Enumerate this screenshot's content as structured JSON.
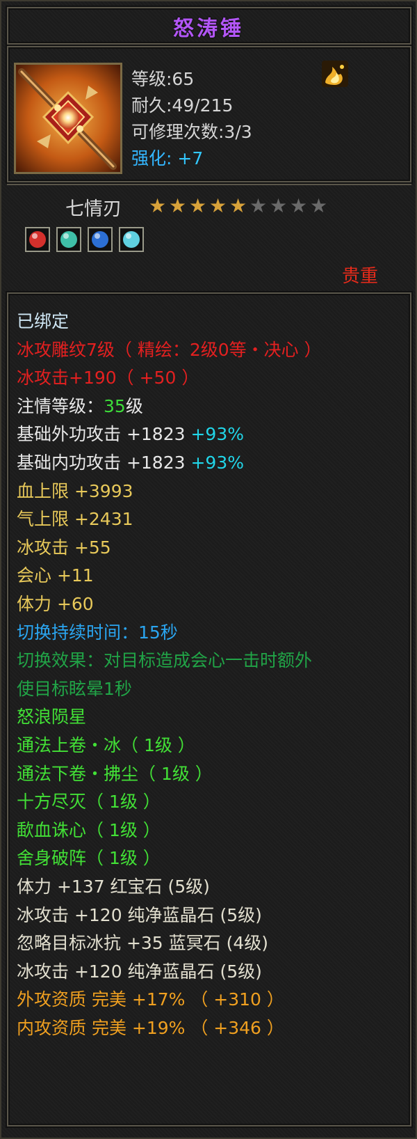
{
  "item": {
    "name": "怒涛锤",
    "level_text": "等级:65",
    "durability_text": "耐久:49/215",
    "repair_text": "可修理次数:3/3",
    "enhance_label": "强化:",
    "enhance_value": "+7",
    "badge_icon": "gold-flame-icon",
    "item_icon": "ornate-hammer-icon"
  },
  "set": {
    "name": "七情刃",
    "stars_total": 9,
    "stars_filled": 5,
    "star_color_filled": "#d8a23a",
    "star_color_empty": "#6a6a6a"
  },
  "gems": [
    {
      "icon": "red-gem-icon",
      "color": "#d4302c"
    },
    {
      "icon": "green-gem-icon",
      "color": "#3fbfa8"
    },
    {
      "icon": "blue-gem-icon",
      "color": "#2c6fd4"
    },
    {
      "icon": "cyan-gem-icon",
      "color": "#5fd0e0"
    }
  ],
  "rarity": "贵重",
  "attributes": [
    {
      "parts": [
        {
          "text": "已绑定",
          "c": "c-light"
        }
      ]
    },
    {
      "parts": [
        {
          "text": "冰攻雕纹7级（ 精绘：2级0等・决心 ）",
          "c": "c-red"
        }
      ]
    },
    {
      "parts": [
        {
          "text": "冰攻击+190（ +50 ）",
          "c": "c-red"
        }
      ]
    },
    {
      "parts": [
        {
          "text": "注情等级：",
          "c": "c-white"
        },
        {
          "text": "35",
          "c": "c-green"
        },
        {
          "text": "级",
          "c": "c-white"
        }
      ]
    },
    {
      "parts": [
        {
          "text": "基础外功攻击 +1823 ",
          "c": "c-white"
        },
        {
          "text": "+93%",
          "c": "c-cyan"
        }
      ]
    },
    {
      "parts": [
        {
          "text": "基础内功攻击 +1823 ",
          "c": "c-white"
        },
        {
          "text": "+93%",
          "c": "c-cyan"
        }
      ]
    },
    {
      "parts": [
        {
          "text": "血上限 +3993",
          "c": "c-yellow"
        }
      ]
    },
    {
      "parts": [
        {
          "text": "气上限 +2431",
          "c": "c-yellow"
        }
      ]
    },
    {
      "parts": [
        {
          "text": "冰攻击 +55",
          "c": "c-yellow"
        }
      ]
    },
    {
      "parts": [
        {
          "text": "会心 +11",
          "c": "c-yellow"
        }
      ]
    },
    {
      "parts": [
        {
          "text": "体力 +60",
          "c": "c-yellow"
        }
      ]
    },
    {
      "parts": [
        {
          "text": "切换持续时间：15秒",
          "c": "c-blue"
        }
      ]
    },
    {
      "parts": [
        {
          "text": "切换效果：对目标造成会心一击时额外",
          "c": "c-dgreen"
        }
      ]
    },
    {
      "parts": [
        {
          "text": "使目标眩晕1秒",
          "c": "c-dgreen"
        }
      ]
    },
    {
      "parts": [
        {
          "text": "怒浪陨星",
          "c": "c-bgreen"
        }
      ]
    },
    {
      "parts": [
        {
          "text": "通法上卷・冰（ 1级 ）",
          "c": "c-bgreen"
        }
      ]
    },
    {
      "parts": [
        {
          "text": "通法下卷・拂尘（ 1级 ）",
          "c": "c-bgreen"
        }
      ]
    },
    {
      "parts": [
        {
          "text": "十方尽灭（ 1级 ）",
          "c": "c-bgreen"
        }
      ]
    },
    {
      "parts": [
        {
          "text": "歃血诛心（ 1级 ）",
          "c": "c-bgreen"
        }
      ]
    },
    {
      "parts": [
        {
          "text": "舍身破阵（ 1级 ）",
          "c": "c-bgreen"
        }
      ]
    },
    {
      "parts": [
        {
          "text": "体力 +137 红宝石 (5级)",
          "c": "c-tan"
        }
      ]
    },
    {
      "parts": [
        {
          "text": "冰攻击 +120 纯净蓝晶石 (5级)",
          "c": "c-tan"
        }
      ]
    },
    {
      "parts": [
        {
          "text": "忽略目标冰抗 +35 蓝冥石 (4级)",
          "c": "c-tan"
        }
      ]
    },
    {
      "parts": [
        {
          "text": "冰攻击 +120 纯净蓝晶石 (5级)",
          "c": "c-tan"
        }
      ]
    },
    {
      "parts": [
        {
          "text": "外攻资质 完美 +17% （ +310 ）",
          "c": "c-orange"
        }
      ]
    },
    {
      "parts": [
        {
          "text": "内攻资质 完美 +19% （ +346 ）",
          "c": "c-orange"
        }
      ]
    }
  ]
}
